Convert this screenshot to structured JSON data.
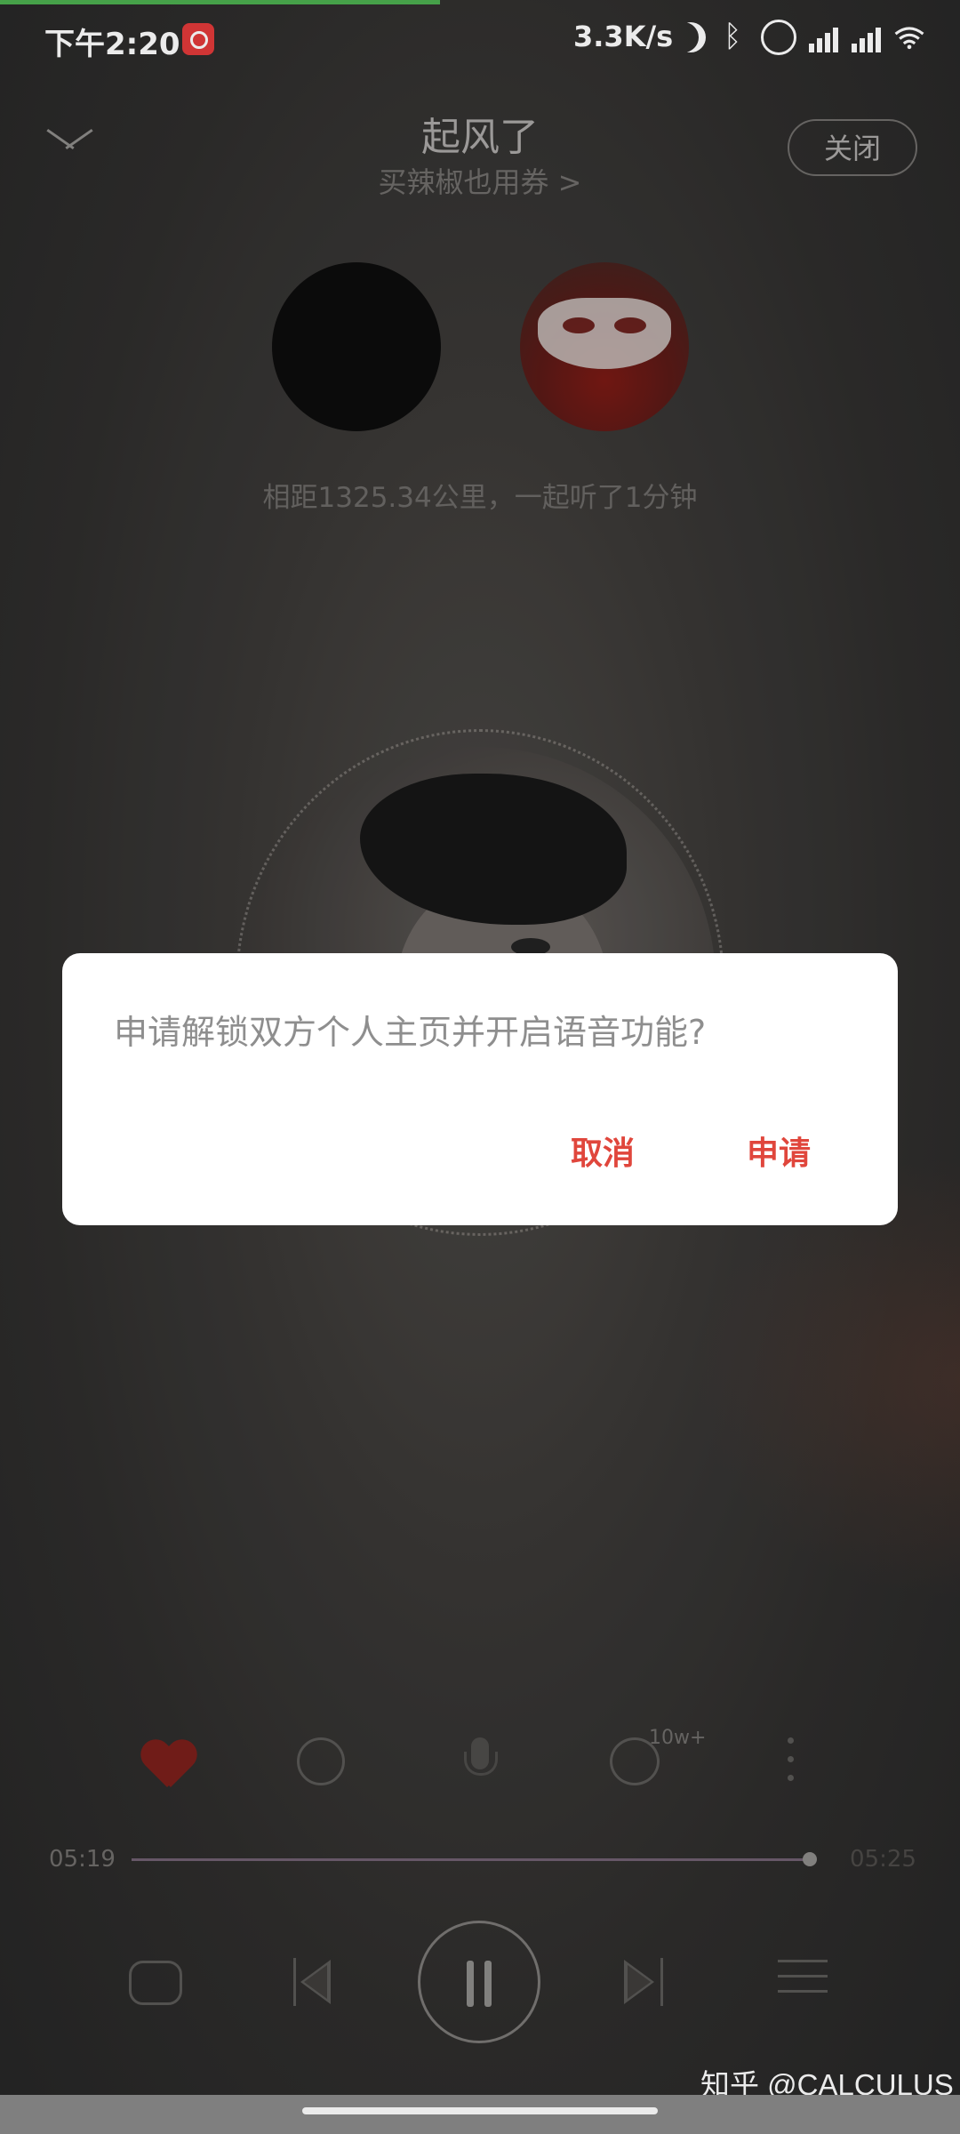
{
  "status_bar": {
    "time": "下午2:20",
    "net_speed": "3.3K/s",
    "icons": [
      "netease-music-icon",
      "moon-icon",
      "bluetooth-icon",
      "alarm-icon",
      "hd-signal-icon",
      "hd-signal-icon",
      "wifi-icon"
    ]
  },
  "header": {
    "song_title": "起风了",
    "subtitle": "买辣椒也用券 >",
    "close_label": "关闭"
  },
  "listen_together": {
    "distance_text": "相距1325.34公里，一起听了1分钟"
  },
  "actions": {
    "comment_count": "10w+"
  },
  "player": {
    "current_time": "05:19",
    "total_time": "05:25",
    "progress": 0.98
  },
  "dialog": {
    "message": "申请解锁双方个人主页并开启语音功能?",
    "cancel_label": "取消",
    "confirm_label": "申请"
  },
  "watermark": "知乎 @CALCULUS",
  "colors": {
    "accent_red": "#e0463c",
    "top_progress_green": "#4caf50"
  }
}
